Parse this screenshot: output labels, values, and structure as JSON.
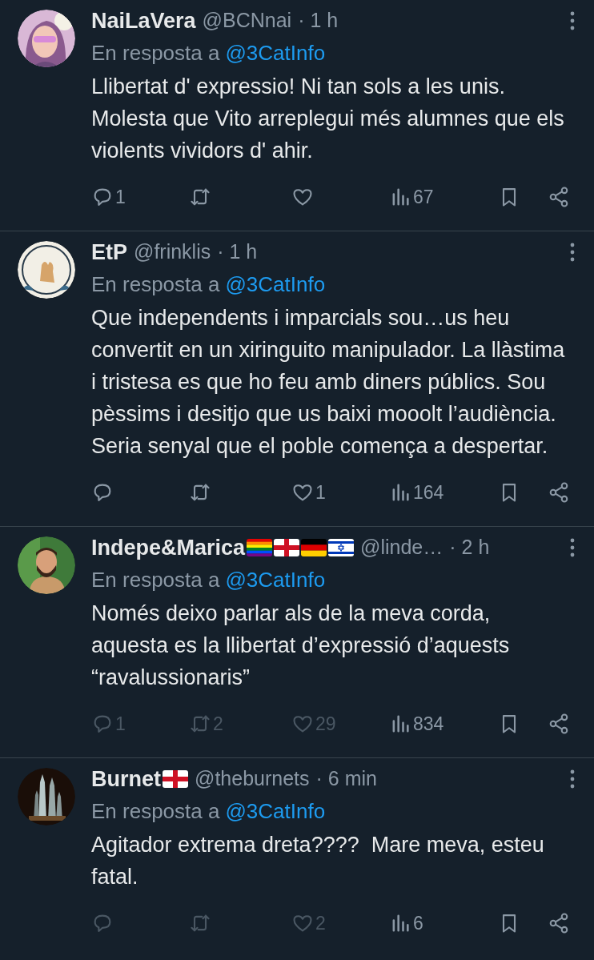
{
  "tweets": [
    {
      "author": {
        "name": "NaiLaVera",
        "handle": "@BCNnai",
        "time": "· 1 h"
      },
      "reply_to": {
        "label": "En resposta a",
        "handle": "@3CatInfo"
      },
      "text": "Llibertat d' expressio! Ni tan sols a les unis. Molesta que Vito arreplegui més alumnes que els violents vividors d' ahir.",
      "actions": {
        "replies": "1",
        "views": "67",
        "dimmed": false
      }
    },
    {
      "author": {
        "name": "EtP",
        "handle": "@frinklis",
        "time": "· 1 h"
      },
      "reply_to": {
        "label": "En resposta a",
        "handle": "@3CatInfo"
      },
      "text": "Que independents i imparcials sou…us heu convertit en un xiringuito manipulador. La llàstima i tristesa es que ho feu amb diners públics. Sou pèssims i desitjo que us baixi mooolt l’audiència. Seria senyal que el poble comença a despertar.",
      "actions": {
        "likes": "1",
        "views": "164",
        "dimmed": false
      }
    },
    {
      "author": {
        "name": "Indepe&Marica",
        "flags": [
          {
            "kind": "rainbow"
          },
          {
            "kind": "england"
          },
          {
            "kind": "germany"
          },
          {
            "kind": "israel"
          }
        ],
        "handle": "@linde…",
        "time": "· 2 h"
      },
      "reply_to": {
        "label": "En resposta a",
        "handle": "@3CatInfo"
      },
      "text": "Només deixo parlar als de la meva corda, aquesta es la llibertat d’expressió d’aquests “ravalussionaris”",
      "actions": {
        "replies": "1",
        "reposts": "2",
        "likes": "29",
        "views": "834",
        "dimmed": true
      }
    },
    {
      "author": {
        "name": "Burnet",
        "flags": [
          {
            "kind": "england"
          }
        ],
        "handle": "@theburnets",
        "time": "· 6 min"
      },
      "reply_to": {
        "label": "En resposta a",
        "handle": "@3CatInfo"
      },
      "text": "Agitador extrema dreta????  Mare meva, esteu fatal.",
      "actions": {
        "likes": "2",
        "views": "6",
        "dimmed": true
      }
    }
  ]
}
